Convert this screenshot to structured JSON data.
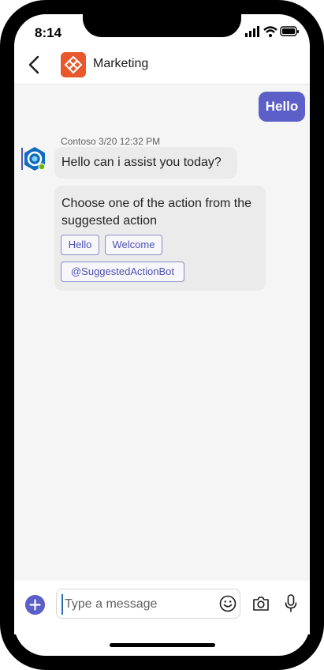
{
  "status_bar": {
    "time": "8:14"
  },
  "header": {
    "title": "Marketing"
  },
  "messages": {
    "sent_text": "Hello",
    "bot_meta": "Contoso 3/20 12:32 PM",
    "bot_text": "Hello can i assist you today?",
    "card_text": "Choose one of the action from the suggested action",
    "actions": [
      "Hello",
      "Welcome",
      "@SuggestedActionBot"
    ]
  },
  "compose": {
    "placeholder": "Type a message"
  },
  "colors": {
    "accent": "#5b5fc7",
    "channel_avatar": "#e8582c",
    "bot_avatar": "#0f6cbd",
    "presence": "#6bb700"
  }
}
